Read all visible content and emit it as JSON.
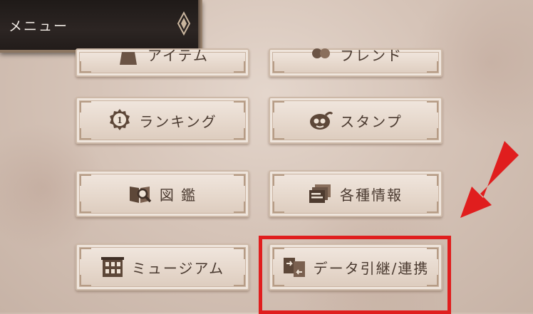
{
  "header": {
    "title": "メニュー"
  },
  "menu": {
    "items": [
      {
        "label": "アイテム",
        "icon": "bag-icon"
      },
      {
        "label": "フレンド",
        "icon": "friend-icon"
      },
      {
        "label": "ランキング",
        "icon": "ranking-medal-icon",
        "badge": "1"
      },
      {
        "label": "スタンプ",
        "icon": "stamp-icon"
      },
      {
        "label": "図 鑑",
        "icon": "book-magnifier-icon"
      },
      {
        "label": "各種情報",
        "icon": "info-cards-icon"
      },
      {
        "label": "ミュージアム",
        "icon": "museum-icon"
      },
      {
        "label": "データ引継/連携",
        "icon": "data-transfer-icon"
      }
    ]
  },
  "colors": {
    "highlight": "#e01e1e",
    "arrow": "#e01e1e",
    "button_text": "#4a3a30"
  }
}
